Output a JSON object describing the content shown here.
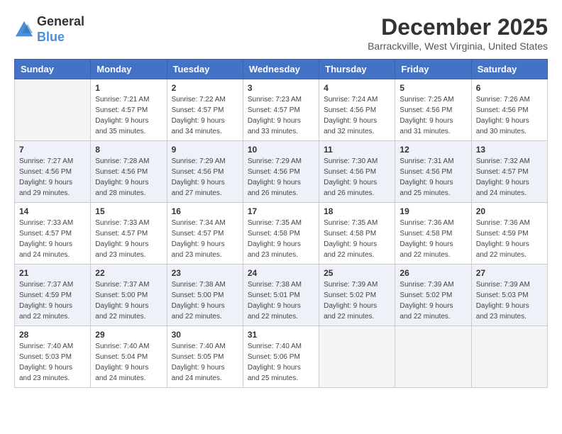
{
  "logo": {
    "text_general": "General",
    "text_blue": "Blue"
  },
  "title": "December 2025",
  "subtitle": "Barrackville, West Virginia, United States",
  "days_of_week": [
    "Sunday",
    "Monday",
    "Tuesday",
    "Wednesday",
    "Thursday",
    "Friday",
    "Saturday"
  ],
  "weeks": [
    [
      {
        "day": "",
        "info": ""
      },
      {
        "day": "1",
        "info": "Sunrise: 7:21 AM\nSunset: 4:57 PM\nDaylight: 9 hours\nand 35 minutes."
      },
      {
        "day": "2",
        "info": "Sunrise: 7:22 AM\nSunset: 4:57 PM\nDaylight: 9 hours\nand 34 minutes."
      },
      {
        "day": "3",
        "info": "Sunrise: 7:23 AM\nSunset: 4:57 PM\nDaylight: 9 hours\nand 33 minutes."
      },
      {
        "day": "4",
        "info": "Sunrise: 7:24 AM\nSunset: 4:56 PM\nDaylight: 9 hours\nand 32 minutes."
      },
      {
        "day": "5",
        "info": "Sunrise: 7:25 AM\nSunset: 4:56 PM\nDaylight: 9 hours\nand 31 minutes."
      },
      {
        "day": "6",
        "info": "Sunrise: 7:26 AM\nSunset: 4:56 PM\nDaylight: 9 hours\nand 30 minutes."
      }
    ],
    [
      {
        "day": "7",
        "info": "Sunrise: 7:27 AM\nSunset: 4:56 PM\nDaylight: 9 hours\nand 29 minutes."
      },
      {
        "day": "8",
        "info": "Sunrise: 7:28 AM\nSunset: 4:56 PM\nDaylight: 9 hours\nand 28 minutes."
      },
      {
        "day": "9",
        "info": "Sunrise: 7:29 AM\nSunset: 4:56 PM\nDaylight: 9 hours\nand 27 minutes."
      },
      {
        "day": "10",
        "info": "Sunrise: 7:29 AM\nSunset: 4:56 PM\nDaylight: 9 hours\nand 26 minutes."
      },
      {
        "day": "11",
        "info": "Sunrise: 7:30 AM\nSunset: 4:56 PM\nDaylight: 9 hours\nand 26 minutes."
      },
      {
        "day": "12",
        "info": "Sunrise: 7:31 AM\nSunset: 4:56 PM\nDaylight: 9 hours\nand 25 minutes."
      },
      {
        "day": "13",
        "info": "Sunrise: 7:32 AM\nSunset: 4:57 PM\nDaylight: 9 hours\nand 24 minutes."
      }
    ],
    [
      {
        "day": "14",
        "info": "Sunrise: 7:33 AM\nSunset: 4:57 PM\nDaylight: 9 hours\nand 24 minutes."
      },
      {
        "day": "15",
        "info": "Sunrise: 7:33 AM\nSunset: 4:57 PM\nDaylight: 9 hours\nand 23 minutes."
      },
      {
        "day": "16",
        "info": "Sunrise: 7:34 AM\nSunset: 4:57 PM\nDaylight: 9 hours\nand 23 minutes."
      },
      {
        "day": "17",
        "info": "Sunrise: 7:35 AM\nSunset: 4:58 PM\nDaylight: 9 hours\nand 23 minutes."
      },
      {
        "day": "18",
        "info": "Sunrise: 7:35 AM\nSunset: 4:58 PM\nDaylight: 9 hours\nand 22 minutes."
      },
      {
        "day": "19",
        "info": "Sunrise: 7:36 AM\nSunset: 4:58 PM\nDaylight: 9 hours\nand 22 minutes."
      },
      {
        "day": "20",
        "info": "Sunrise: 7:36 AM\nSunset: 4:59 PM\nDaylight: 9 hours\nand 22 minutes."
      }
    ],
    [
      {
        "day": "21",
        "info": "Sunrise: 7:37 AM\nSunset: 4:59 PM\nDaylight: 9 hours\nand 22 minutes."
      },
      {
        "day": "22",
        "info": "Sunrise: 7:37 AM\nSunset: 5:00 PM\nDaylight: 9 hours\nand 22 minutes."
      },
      {
        "day": "23",
        "info": "Sunrise: 7:38 AM\nSunset: 5:00 PM\nDaylight: 9 hours\nand 22 minutes."
      },
      {
        "day": "24",
        "info": "Sunrise: 7:38 AM\nSunset: 5:01 PM\nDaylight: 9 hours\nand 22 minutes."
      },
      {
        "day": "25",
        "info": "Sunrise: 7:39 AM\nSunset: 5:02 PM\nDaylight: 9 hours\nand 22 minutes."
      },
      {
        "day": "26",
        "info": "Sunrise: 7:39 AM\nSunset: 5:02 PM\nDaylight: 9 hours\nand 22 minutes."
      },
      {
        "day": "27",
        "info": "Sunrise: 7:39 AM\nSunset: 5:03 PM\nDaylight: 9 hours\nand 23 minutes."
      }
    ],
    [
      {
        "day": "28",
        "info": "Sunrise: 7:40 AM\nSunset: 5:03 PM\nDaylight: 9 hours\nand 23 minutes."
      },
      {
        "day": "29",
        "info": "Sunrise: 7:40 AM\nSunset: 5:04 PM\nDaylight: 9 hours\nand 24 minutes."
      },
      {
        "day": "30",
        "info": "Sunrise: 7:40 AM\nSunset: 5:05 PM\nDaylight: 9 hours\nand 24 minutes."
      },
      {
        "day": "31",
        "info": "Sunrise: 7:40 AM\nSunset: 5:06 PM\nDaylight: 9 hours\nand 25 minutes."
      },
      {
        "day": "",
        "info": ""
      },
      {
        "day": "",
        "info": ""
      },
      {
        "day": "",
        "info": ""
      }
    ]
  ]
}
